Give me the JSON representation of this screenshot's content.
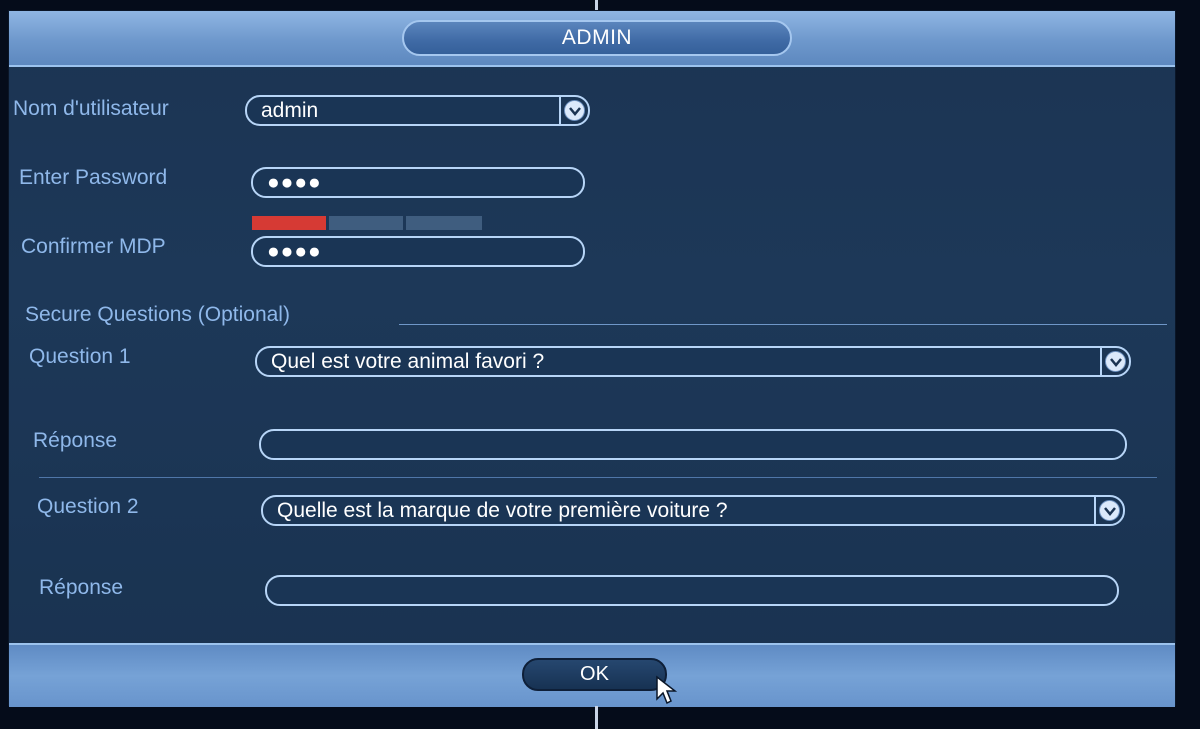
{
  "dialog": {
    "title": "ADMIN"
  },
  "form": {
    "username_label": "Nom d'utilisateur",
    "username_value": "admin",
    "password_label": "Enter Password",
    "password_value": "●●●●",
    "password_strength_level": 0.33,
    "confirm_label": "Confirmer MDP",
    "confirm_value": "●●●●",
    "secure_section_title": "Secure Questions (Optional)",
    "question1_label": "Question 1",
    "question1_value": "Quel est votre animal favori ?",
    "answer1_label": "Réponse",
    "answer1_value": "",
    "question2_label": "Question 2",
    "question2_value": "Quelle est la marque de votre première voiture ?",
    "answer2_label": "Réponse",
    "answer2_value": ""
  },
  "footer": {
    "ok_label": "OK"
  },
  "colors": {
    "strength_active": "#d63a34",
    "strength_inactive": "#3f5d7f",
    "label": "#8fb8ea"
  },
  "icons": {
    "dropdown": "chevron-down-icon",
    "cursor": "mouse-pointer-icon"
  }
}
